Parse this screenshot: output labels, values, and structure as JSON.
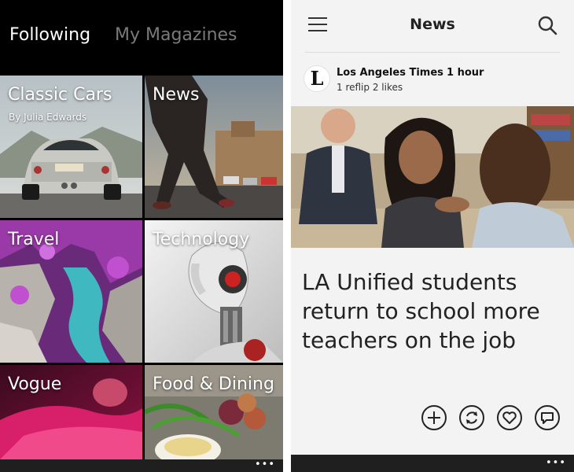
{
  "left": {
    "pivots": {
      "active": "Following",
      "inactive": "My Magazines"
    },
    "tiles": {
      "cars": {
        "title": "Classic Cars",
        "subtitle": "By Julia Edwards"
      },
      "news": {
        "title": "News"
      },
      "travel": {
        "title": "Travel"
      },
      "tech": {
        "title": "Technology"
      },
      "vogue": {
        "title": "Vogue"
      },
      "food": {
        "title": "Food & Dining"
      }
    },
    "appbar": {
      "more": "•••"
    }
  },
  "right": {
    "header": {
      "title": "News",
      "menu_icon": "hamburger-icon",
      "search_icon": "search-icon"
    },
    "source": {
      "logo": "L",
      "name": "Los Angeles Times",
      "time": "1 hour",
      "stats": "1 reflip 2 likes"
    },
    "article": {
      "headline": "LA Unified students return to school more teachers on the job"
    },
    "actions": [
      "add-icon",
      "flip-icon",
      "like-icon",
      "comment-icon"
    ],
    "appbar": {
      "more": "•••"
    }
  }
}
